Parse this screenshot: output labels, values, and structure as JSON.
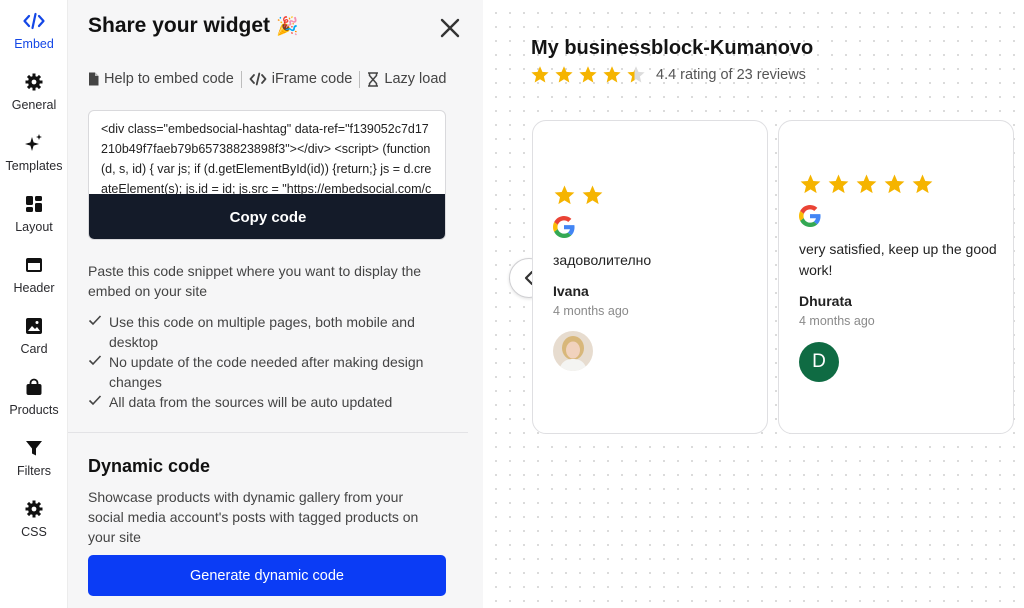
{
  "nav": {
    "items": [
      {
        "label": "Embed",
        "icon": "code-icon",
        "active": true
      },
      {
        "label": "General",
        "icon": "gear-icon"
      },
      {
        "label": "Templates",
        "icon": "sparkle-icon"
      },
      {
        "label": "Layout",
        "icon": "layout-icon"
      },
      {
        "label": "Header",
        "icon": "header-icon"
      },
      {
        "label": "Card",
        "icon": "image-icon"
      },
      {
        "label": "Products",
        "icon": "bag-icon"
      },
      {
        "label": "Filters",
        "icon": "filter-icon"
      },
      {
        "label": "CSS",
        "icon": "gear-icon"
      }
    ]
  },
  "panel": {
    "title": "Share your widget",
    "title_emoji": "🎉",
    "tabs": [
      {
        "label": "Help to embed code",
        "icon": "document-icon"
      },
      {
        "label": "iFrame code",
        "icon": "code-icon"
      },
      {
        "label": "Lazy load",
        "icon": "hourglass-icon"
      }
    ],
    "code_snippet": "<div class=\"embedsocial-hashtag\" data-ref=\"f139052c7d17210b49f7faeb79b65738823898f3\"></div> <script> (function(d, s, id) { var js; if (d.getElementById(id)) {return;} js = d.createElement(s); js.id = id; js.src = \"https://embedsocial.com/cdn/ht.js\";",
    "copy_button": "Copy code",
    "paste_description": "Paste this code snippet where you want to display the embed on your site",
    "checklist": [
      "Use this code on multiple pages, both mobile and desktop",
      "No update of the code needed after making design changes",
      "All data from the sources will be auto updated"
    ],
    "dynamic_title": "Dynamic code",
    "dynamic_description": "Showcase products with dynamic gallery from your social media account's posts with tagged products on your site",
    "dynamic_button": "Generate dynamic code"
  },
  "preview": {
    "business_name": "My businessblock-Kumanovo",
    "rating_value": 4.4,
    "rating_text": "4.4 rating of 23 reviews",
    "colors": {
      "star": "#f5b400",
      "avatar_bg": "#0f6b43"
    },
    "reviews": [
      {
        "stars": 2,
        "source": "google-icon",
        "text": "задоволително",
        "name": "Ivana",
        "when": "4 months ago",
        "avatar": "photo"
      },
      {
        "stars": 5,
        "source": "google-icon",
        "text": "very satisfied, keep up the good work!",
        "name": "Dhurata",
        "when": "4 months ago",
        "avatar_letter": "D"
      }
    ]
  }
}
